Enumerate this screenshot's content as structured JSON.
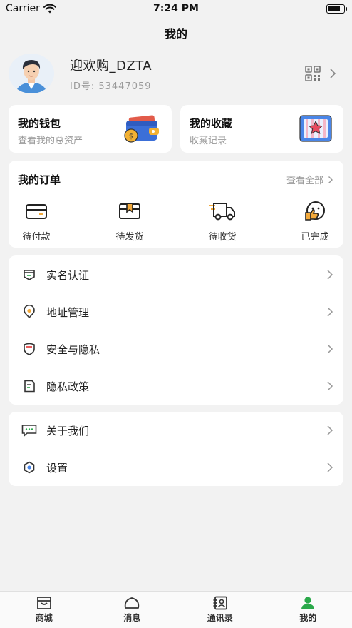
{
  "status_bar": {
    "carrier": "Carrier",
    "time": "7:24 PM"
  },
  "header": {
    "title": "我的"
  },
  "profile": {
    "username": "迎欢购_DZTA",
    "user_id": "ID号: 53447059"
  },
  "wallet": {
    "title": "我的钱包",
    "subtitle": "查看我的总资产"
  },
  "favorites": {
    "title": "我的收藏",
    "subtitle": "收藏记录"
  },
  "orders": {
    "title": "我的订单",
    "view_all": "查看全部",
    "items": [
      {
        "label": "待付款",
        "icon": "card-icon"
      },
      {
        "label": "待发货",
        "icon": "package-icon"
      },
      {
        "label": "待收货",
        "icon": "truck-icon"
      },
      {
        "label": "已完成",
        "icon": "thumbs-up-icon"
      }
    ]
  },
  "menu_group_1": [
    {
      "label": "实名认证",
      "icon": "id-card-icon"
    },
    {
      "label": "地址管理",
      "icon": "location-icon"
    },
    {
      "label": "安全与隐私",
      "icon": "shield-icon"
    },
    {
      "label": "隐私政策",
      "icon": "document-icon"
    }
  ],
  "menu_group_2": [
    {
      "label": "关于我们",
      "icon": "chat-icon"
    },
    {
      "label": "设置",
      "icon": "settings-icon"
    }
  ],
  "tab_bar": [
    {
      "label": "商城",
      "icon": "shop-icon"
    },
    {
      "label": "消息",
      "icon": "message-icon"
    },
    {
      "label": "通讯录",
      "icon": "contacts-icon"
    },
    {
      "label": "我的",
      "icon": "profile-icon",
      "active": true
    }
  ],
  "colors": {
    "accent": "#2aa84a",
    "background": "#f2f2f2",
    "card": "#ffffff",
    "muted_text": "#9a9a9a"
  }
}
